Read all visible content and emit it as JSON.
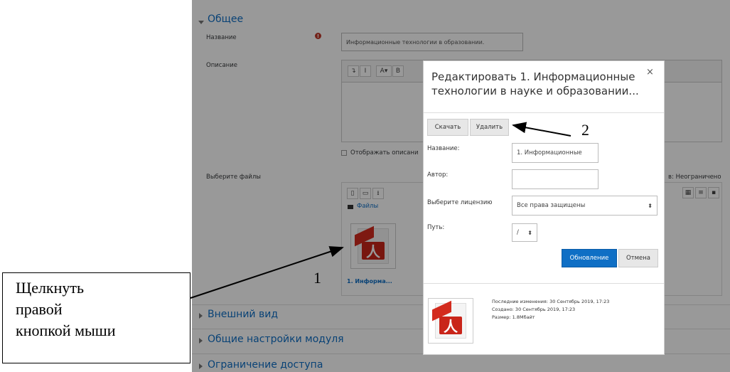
{
  "form": {
    "section_general": "Общее",
    "name_label": "Название",
    "name_value": "Информационные технологии в образовании.",
    "description_label": "Описание",
    "show_description": "Отображать описани",
    "files_label": "Выберите файлы",
    "max_files_note": "в: Неограничено",
    "files_folder": "Файлы",
    "file_name": "1. Информа...",
    "sections": [
      {
        "label": "Внешний вид"
      },
      {
        "label": "Общие настройки модуля"
      },
      {
        "label": "Ограничение доступа"
      }
    ],
    "editor_buttons": [
      "↴",
      "I",
      "A▾",
      "B"
    ]
  },
  "dialog": {
    "title": "Редактировать 1. Информационные технологии в науке и образовании...",
    "close": "×",
    "download_button": "Скачать",
    "delete_button": "Удалить",
    "name_label": "Название:",
    "name_value": "1. Информационные",
    "author_label": "Автор:",
    "author_value": "",
    "license_label": "Выберите лицензию",
    "license_value": "Все права защищены",
    "path_label": "Путь:",
    "path_value": "/",
    "update_button": "Обновление",
    "cancel_button": "Отмена",
    "modified": "Последние изменения: 30 Сентябрь 2019, 17:23",
    "created": "Создано: 30 Сентябрь 2019, 17:23",
    "size": "Размер: 1.8Мбайт"
  },
  "annotations": {
    "callout": "Щелкнуть\nправой\nкнопкой мыши",
    "number_1": "1",
    "number_2": "2"
  },
  "colors": {
    "link": "#0f6fc5",
    "primary_button": "#0f6fc5",
    "pdf_red": "#c9251a"
  }
}
